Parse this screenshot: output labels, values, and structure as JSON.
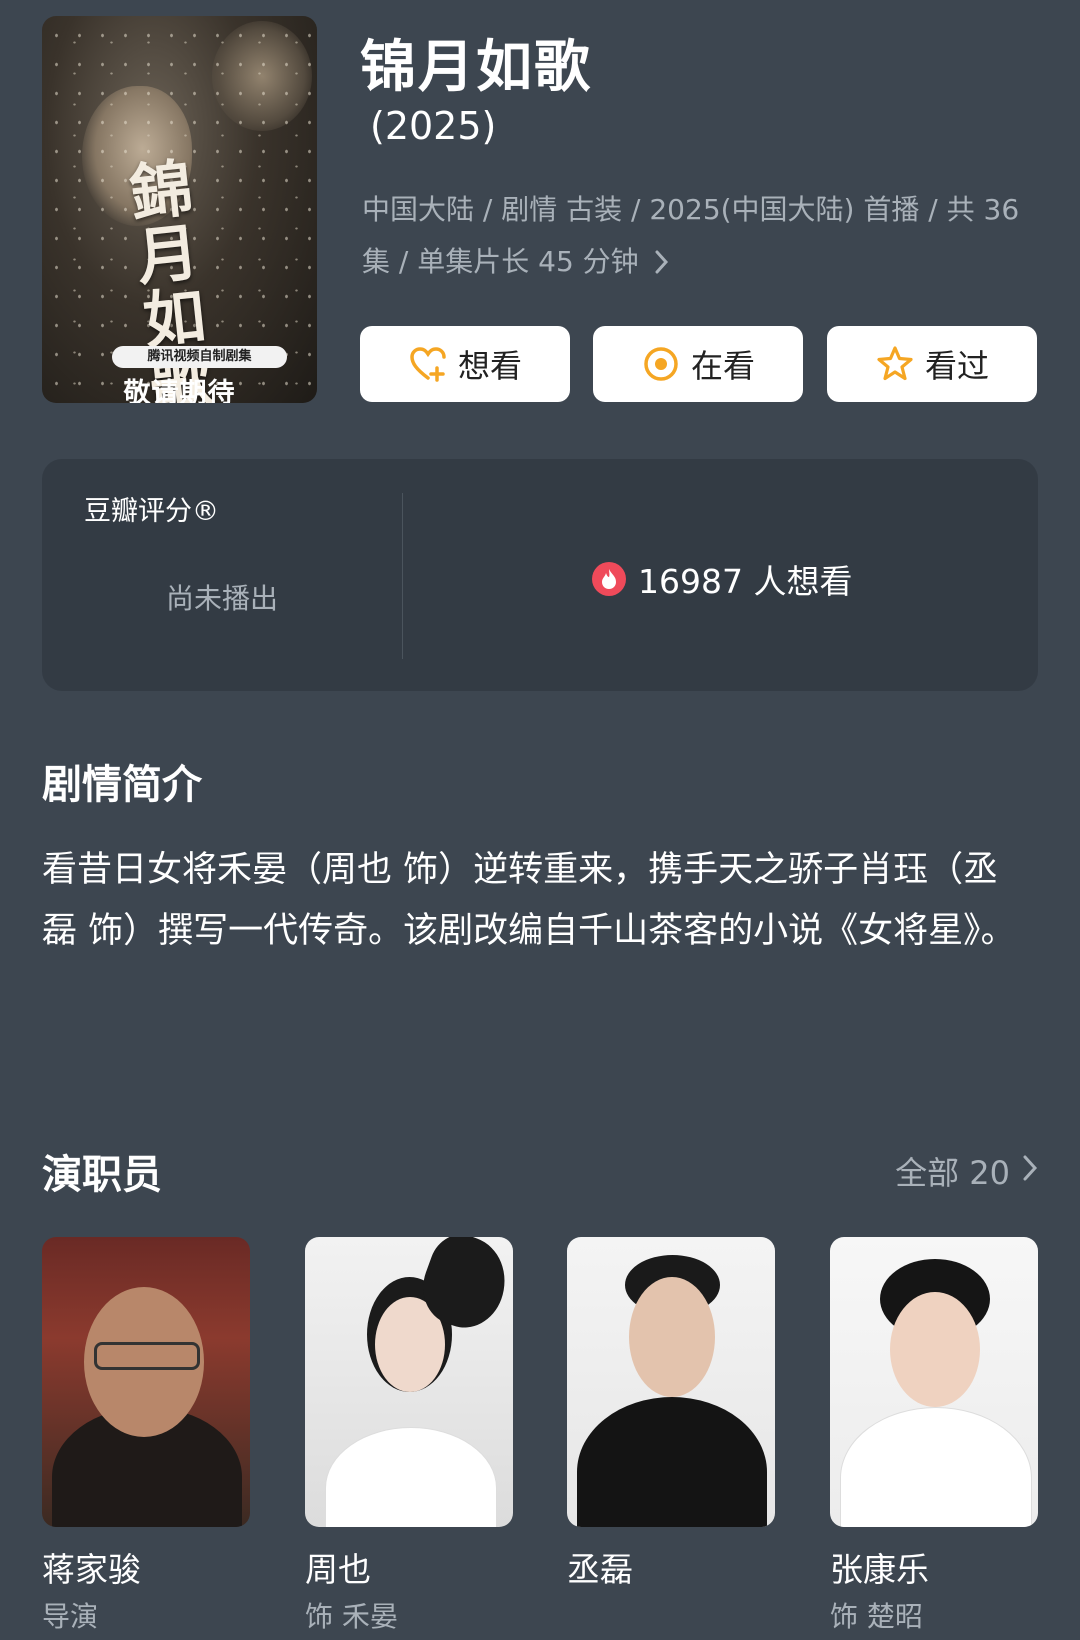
{
  "poster": {
    "calligraphy": "錦月如歌",
    "tag": "腾讯视频自制剧集",
    "cta": "敬请期待"
  },
  "header": {
    "title": "锦月如歌",
    "year": "(2025)",
    "meta": "中国大陆 / 剧情 古装 / 2025(中国大陆) 首播 / 共 36集 / 单集片长 45 分钟"
  },
  "actions": {
    "want": "想看",
    "watching": "在看",
    "watched": "看过"
  },
  "colors": {
    "accent": "#f5a623",
    "fire": "#ef4a5a"
  },
  "rating": {
    "label": "豆瓣评分®",
    "status": "尚未播出",
    "want_count": "16987 人想看"
  },
  "synopsis": {
    "title": "剧情简介",
    "text": "看昔日女将禾晏（周也 饰）逆转重来，携手天之骄子肖珏（丞磊 饰）撰写一代传奇。该剧改编自千山茶客的小说《女将星》。"
  },
  "cast": {
    "title": "演职员",
    "all_label": "全部 20",
    "members": [
      {
        "name": "蒋家骏",
        "role": "导演"
      },
      {
        "name": "周也",
        "role": "饰 禾晏"
      },
      {
        "name": "丞磊",
        "role": ""
      },
      {
        "name": "张康乐",
        "role": "饰 楚昭"
      }
    ]
  }
}
